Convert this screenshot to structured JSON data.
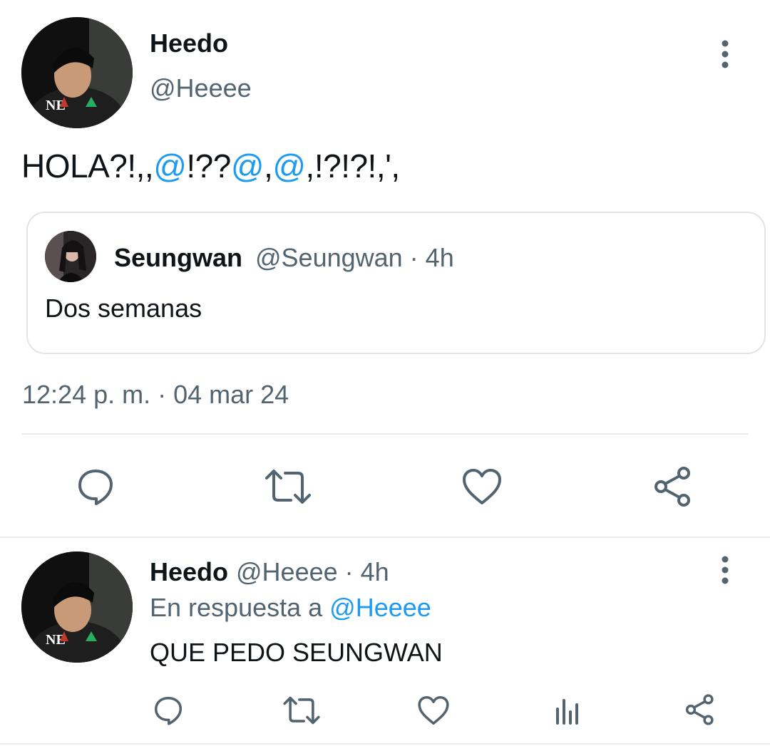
{
  "main_tweet": {
    "display_name": "Heedo",
    "handle": "@Heeee",
    "text_parts": [
      "HOLA?!,,",
      "@",
      "!??",
      "@",
      ",",
      "@",
      ",!?!?!,',"
    ],
    "timestamp": "12:24 p. m. · 04 mar 24",
    "more_icon": "more-vertical-icon",
    "actions": [
      "reply-icon",
      "retweet-icon",
      "like-icon",
      "share-icon"
    ]
  },
  "quoted_tweet": {
    "display_name": "Seungwan",
    "meta": "@Seungwan · 4h",
    "text": "Dos semanas"
  },
  "reply_tweet": {
    "display_name": "Heedo",
    "meta": "@Heeee · 4h",
    "reply_prefix": "En respuesta a ",
    "reply_handle": "@Heeee",
    "text": "QUE PEDO SEUNGWAN",
    "more_icon": "more-vertical-icon",
    "actions": [
      "reply-icon",
      "retweet-icon",
      "like-icon",
      "analytics-icon",
      "share-icon"
    ]
  },
  "colors": {
    "text": "#0f1419",
    "secondary": "#536471",
    "accent": "#1d9bf0",
    "divider": "#e8ecef"
  }
}
